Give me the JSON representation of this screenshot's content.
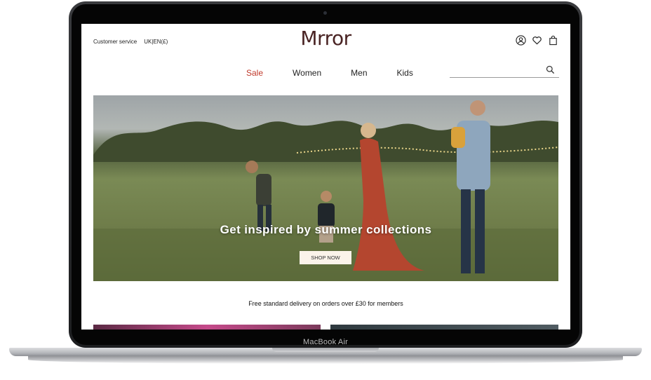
{
  "device": {
    "label": "MacBook Air"
  },
  "header": {
    "customer_service": "Customer service",
    "region": "UK|EN(£)",
    "logo": "Mrror",
    "icons": [
      "account-icon",
      "heart-icon",
      "bag-icon"
    ]
  },
  "nav": {
    "items": [
      {
        "label": "Sale"
      },
      {
        "label": "Women"
      },
      {
        "label": "Men"
      },
      {
        "label": "Kids"
      }
    ]
  },
  "search": {
    "placeholder": "",
    "icon": "search-icon"
  },
  "hero": {
    "title": "Get inspired by summer collections",
    "button": "SHOP NOW"
  },
  "delivery": {
    "text": "Free standard delivery on orders over £30 for members"
  },
  "colors": {
    "accent": "#c0392b",
    "logo": "#4a2424",
    "button_bg": "#fbf3ea"
  }
}
